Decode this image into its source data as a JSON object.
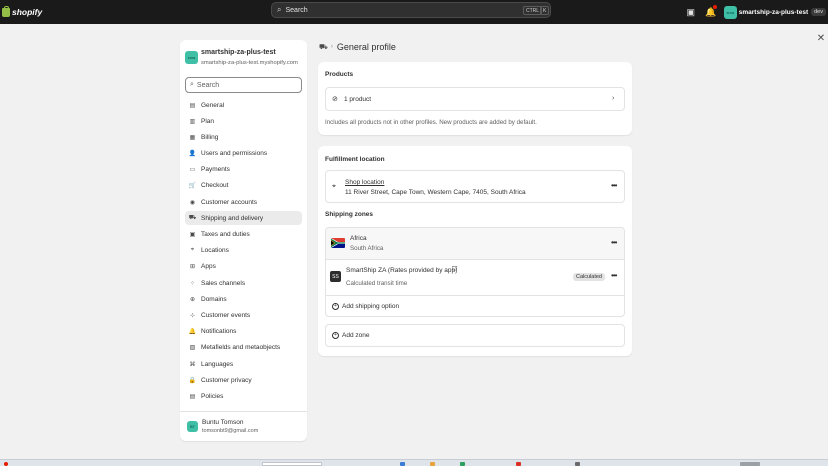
{
  "topbar": {
    "logo_text": "shopify",
    "search_placeholder": "Search",
    "kbd_ctrl": "CTRL",
    "kbd_k": "K",
    "store_avatar": "sma",
    "store_name": "smartship-za-plus-test",
    "dev_badge": "dev"
  },
  "sidebar": {
    "store_name": "smartship-za-plus-test",
    "store_domain": "smartship-za-plus-test.myshopify.com",
    "store_avatar": "sma",
    "search_placeholder": "Search",
    "items": [
      {
        "label": "General",
        "icon": "store-icon",
        "glyph": "▤"
      },
      {
        "label": "Plan",
        "icon": "plan-icon",
        "glyph": "▥"
      },
      {
        "label": "Billing",
        "icon": "billing-icon",
        "glyph": "▦"
      },
      {
        "label": "Users and permissions",
        "icon": "users-icon",
        "glyph": "👤"
      },
      {
        "label": "Payments",
        "icon": "payments-icon",
        "glyph": "▭"
      },
      {
        "label": "Checkout",
        "icon": "cart-icon",
        "glyph": "🛒"
      },
      {
        "label": "Customer accounts",
        "icon": "customer-icon",
        "glyph": "◉"
      },
      {
        "label": "Shipping and delivery",
        "icon": "truck-icon",
        "glyph": "⛟"
      },
      {
        "label": "Taxes and duties",
        "icon": "tax-icon",
        "glyph": "▣"
      },
      {
        "label": "Locations",
        "icon": "location-icon",
        "glyph": "⌖"
      },
      {
        "label": "Apps",
        "icon": "apps-icon",
        "glyph": "⊞"
      },
      {
        "label": "Sales channels",
        "icon": "channels-icon",
        "glyph": "⁘"
      },
      {
        "label": "Domains",
        "icon": "globe-icon",
        "glyph": "⊕"
      },
      {
        "label": "Customer events",
        "icon": "events-icon",
        "glyph": "⊹"
      },
      {
        "label": "Notifications",
        "icon": "bell-icon",
        "glyph": "🔔"
      },
      {
        "label": "Metafields and metaobjects",
        "icon": "metafields-icon",
        "glyph": "▧"
      },
      {
        "label": "Languages",
        "icon": "language-icon",
        "glyph": "⌘"
      },
      {
        "label": "Customer privacy",
        "icon": "lock-icon",
        "glyph": "🔒"
      },
      {
        "label": "Policies",
        "icon": "policy-icon",
        "glyph": "▤"
      }
    ],
    "active_item": "Shipping and delivery",
    "user": {
      "avatar": "BT",
      "name": "Buntu Tomson",
      "email": "tomsonbt9@gmail.com"
    }
  },
  "page": {
    "breadcrumb_title": "General profile"
  },
  "products_card": {
    "title": "Products",
    "product_count": "1 product",
    "help_text": "Includes all products not in other profiles. New products are added by default."
  },
  "fulfillment_card": {
    "title": "Fulfillment location",
    "location_name": "Shop location",
    "location_address": "11 River Street, Cape Town, Western Cape, 7405, South Africa",
    "zones_title": "Shipping zones",
    "zone": {
      "name": "Africa",
      "country": "South Africa"
    },
    "rate": {
      "name": "SmartShip ZA (Rates provided by app)",
      "transit": "Calculated transit time",
      "badge": "Calculated",
      "app_icon": "SS"
    },
    "add_shipping_option": "Add shipping option",
    "add_zone": "Add zone"
  },
  "colors": {
    "topbar_bg": "#1a1a1a",
    "page_bg": "#f1f1f1",
    "card_bg": "#ffffff",
    "active_nav": "#ebebeb",
    "avatar_teal": "#3fbfa6",
    "shopify_green": "#95bf47"
  }
}
